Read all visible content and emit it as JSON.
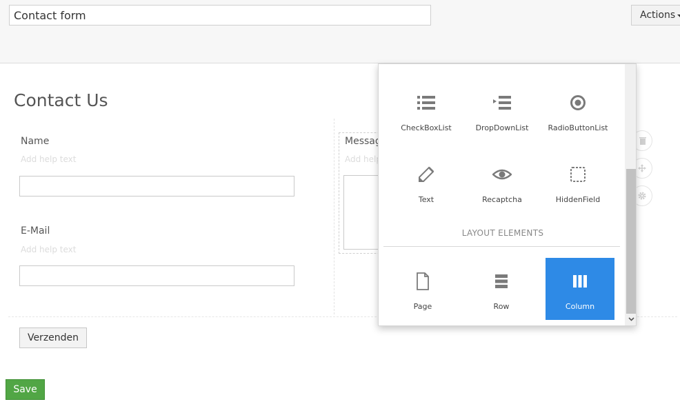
{
  "header": {
    "form_title_value": "Contact form",
    "actions_label": "Actions"
  },
  "form": {
    "heading": "Contact Us",
    "fields": [
      {
        "label": "Name",
        "help": "Add help text"
      },
      {
        "label": "E-Mail",
        "help": "Add help text"
      }
    ],
    "message": {
      "label": "Messag",
      "help": "Add help"
    },
    "submit_label": "Verzenden"
  },
  "footer": {
    "save_label": "Save"
  },
  "palette": {
    "form_elements": [
      {
        "label": "CheckBoxList",
        "icon": "list-icon"
      },
      {
        "label": "DropDownList",
        "icon": "dropdown-list-icon"
      },
      {
        "label": "RadioButtonList",
        "icon": "radio-icon"
      },
      {
        "label": "Text",
        "icon": "pencil-icon"
      },
      {
        "label": "Recaptcha",
        "icon": "eye-icon"
      },
      {
        "label": "HiddenField",
        "icon": "dashed-square-icon"
      }
    ],
    "layout_title": "LAYOUT ELEMENTS",
    "layout_elements": [
      {
        "label": "Page",
        "icon": "page-icon"
      },
      {
        "label": "Row",
        "icon": "row-icon"
      },
      {
        "label": "Column",
        "icon": "columns-icon",
        "active": true
      }
    ]
  },
  "colors": {
    "active_tile": "#2e8ae6",
    "save_button": "#51a645",
    "icon_gray": "#7a7a7a"
  }
}
